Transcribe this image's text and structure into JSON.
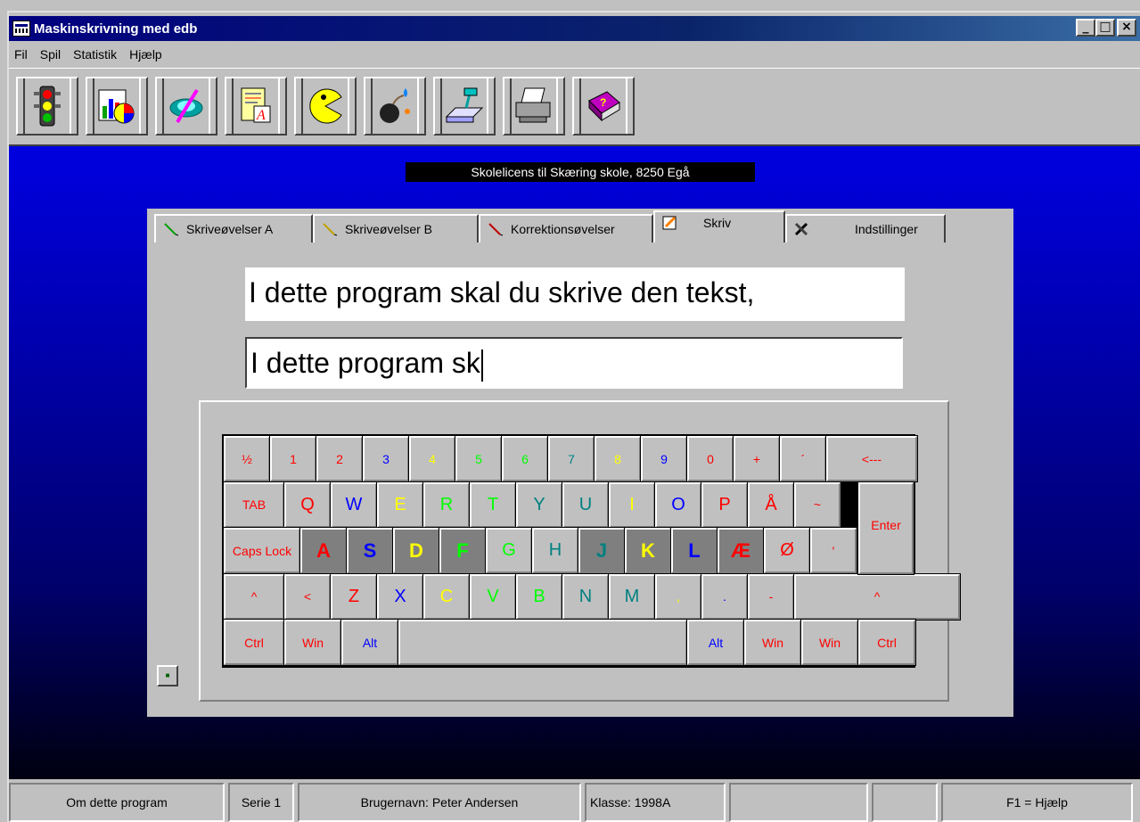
{
  "window": {
    "title": "Maskinskrivning med edb"
  },
  "menu": [
    {
      "label": "Fil"
    },
    {
      "label": "Spil"
    },
    {
      "label": "Statistik"
    },
    {
      "label": "Hjælp"
    }
  ],
  "toolbar": [
    {
      "icon": "traffic-light-icon"
    },
    {
      "icon": "statistics-chart-icon"
    },
    {
      "icon": "game-disc-icon"
    },
    {
      "icon": "document-edit-icon"
    },
    {
      "icon": "pacman-icon"
    },
    {
      "icon": "bomb-icon"
    },
    {
      "icon": "scanner-icon"
    },
    {
      "icon": "printer-icon"
    },
    {
      "icon": "help-book-icon"
    }
  ],
  "license": "Skolelicens til  Skæring skole,  8250  Egå",
  "tabs": [
    {
      "label": "Skriveøvelser A",
      "icon": "pencil-icon"
    },
    {
      "label": "Skriveøvelser B",
      "icon": "pencil-icon"
    },
    {
      "label": "Korrektionsøvelser",
      "icon": "pencil-icon"
    },
    {
      "label": "Skriv",
      "icon": "write-icon",
      "active": true
    },
    {
      "label": "Indstillinger",
      "icon": "tools-icon"
    }
  ],
  "exercise": {
    "target_text": "I dette program skal du skrive den tekst,",
    "typed_text": "I dette program sk"
  },
  "keyboard": {
    "rows": [
      [
        {
          "label": "½",
          "color": "#ff0000",
          "w": 52
        },
        {
          "label": "1",
          "color": "#ff0000",
          "w": 52
        },
        {
          "label": "2",
          "color": "#ff0000",
          "w": 52
        },
        {
          "label": "3",
          "color": "#0000ff",
          "w": 52
        },
        {
          "label": "4",
          "color": "#ffff00",
          "w": 52
        },
        {
          "label": "5",
          "color": "#00ff00",
          "w": 52
        },
        {
          "label": "6",
          "color": "#00ff00",
          "w": 52
        },
        {
          "label": "7",
          "color": "#008080",
          "w": 52
        },
        {
          "label": "8",
          "color": "#ffff00",
          "w": 52
        },
        {
          "label": "9",
          "color": "#0000ff",
          "w": 52
        },
        {
          "label": "0",
          "color": "#ff0000",
          "w": 52
        },
        {
          "label": "+",
          "color": "#ff0000",
          "w": 52
        },
        {
          "label": "´",
          "color": "#ff0000",
          "w": 52
        },
        {
          "label": "<---",
          "color": "#ff0000",
          "w": 102
        }
      ],
      [
        {
          "label": "TAB",
          "color": "#ff0000",
          "w": 68
        },
        {
          "label": "Q",
          "color": "#ff0000",
          "w": 52,
          "big": true
        },
        {
          "label": "W",
          "color": "#0000ff",
          "w": 52,
          "big": true
        },
        {
          "label": "E",
          "color": "#ffff00",
          "w": 52,
          "big": true
        },
        {
          "label": "R",
          "color": "#00ff00",
          "w": 52,
          "big": true
        },
        {
          "label": "T",
          "color": "#00ff00",
          "w": 52,
          "big": true
        },
        {
          "label": "Y",
          "color": "#008080",
          "w": 52,
          "big": true
        },
        {
          "label": "U",
          "color": "#008080",
          "w": 52,
          "big": true
        },
        {
          "label": "I",
          "color": "#ffff00",
          "w": 52,
          "big": true
        },
        {
          "label": "O",
          "color": "#0000ff",
          "w": 52,
          "big": true
        },
        {
          "label": "P",
          "color": "#ff0000",
          "w": 52,
          "big": true
        },
        {
          "label": "Å",
          "color": "#ff0000",
          "w": 52,
          "big": true
        },
        {
          "label": "~",
          "color": "#ff0000",
          "w": 52
        }
      ],
      [
        {
          "label": "Caps Lock",
          "color": "#ff0000",
          "w": 86
        },
        {
          "label": "A",
          "color": "#ff0000",
          "w": 52,
          "home": true
        },
        {
          "label": "S",
          "color": "#0000ff",
          "w": 52,
          "home": true
        },
        {
          "label": "D",
          "color": "#ffff00",
          "w": 52,
          "home": true
        },
        {
          "label": "F",
          "color": "#00ff00",
          "w": 52,
          "home": true
        },
        {
          "label": "G",
          "color": "#00ff00",
          "w": 52,
          "big": true
        },
        {
          "label": "H",
          "color": "#008080",
          "w": 52,
          "big": true
        },
        {
          "label": "J",
          "color": "#008080",
          "w": 52,
          "home": true
        },
        {
          "label": "K",
          "color": "#ffff00",
          "w": 52,
          "home": true
        },
        {
          "label": "L",
          "color": "#0000ff",
          "w": 52,
          "home": true
        },
        {
          "label": "Æ",
          "color": "#ff0000",
          "w": 52,
          "home": true
        },
        {
          "label": "Ø",
          "color": "#ff0000",
          "w": 52,
          "big": true
        },
        {
          "label": "'",
          "color": "#ff0000",
          "w": 52
        }
      ],
      [
        {
          "label": "^",
          "color": "#ff0000",
          "w": 68
        },
        {
          "label": "<",
          "color": "#ff0000",
          "w": 52
        },
        {
          "label": "Z",
          "color": "#ff0000",
          "w": 52,
          "big": true
        },
        {
          "label": "X",
          "color": "#0000ff",
          "w": 52,
          "big": true
        },
        {
          "label": "C",
          "color": "#ffff00",
          "w": 52,
          "big": true
        },
        {
          "label": "V",
          "color": "#00ff00",
          "w": 52,
          "big": true
        },
        {
          "label": "B",
          "color": "#00ff00",
          "w": 52,
          "big": true
        },
        {
          "label": "N",
          "color": "#008080",
          "w": 52,
          "big": true
        },
        {
          "label": "M",
          "color": "#008080",
          "w": 52,
          "big": true
        },
        {
          "label": ",",
          "color": "#ffff00",
          "w": 52
        },
        {
          "label": ".",
          "color": "#0000ff",
          "w": 52
        },
        {
          "label": "-",
          "color": "#ff0000",
          "w": 52
        },
        {
          "label": "^",
          "color": "#ff0000",
          "w": 186
        }
      ],
      [
        {
          "label": "Ctrl",
          "color": "#ff0000",
          "w": 68
        },
        {
          "label": "Win",
          "color": "#ff0000",
          "w": 64
        },
        {
          "label": "Alt",
          "color": "#0000ff",
          "w": 64
        },
        {
          "label": "",
          "color": "#000000",
          "w": 324
        },
        {
          "label": "Alt",
          "color": "#0000ff",
          "w": 64
        },
        {
          "label": "Win",
          "color": "#ff0000",
          "w": 64
        },
        {
          "label": "Win",
          "color": "#ff0000",
          "w": 64
        },
        {
          "label": "Ctrl",
          "color": "#ff0000",
          "w": 64
        }
      ]
    ],
    "enter_label": "Enter",
    "enter_color": "#ff0000"
  },
  "statusbar": [
    {
      "label": "Om dette program",
      "w": 242
    },
    {
      "label": "Serie 1",
      "w": 74
    },
    {
      "label": "Brugernavn: Peter Andersen",
      "w": 318
    },
    {
      "label": "Klasse: 1998A",
      "w": 158,
      "align": "left"
    },
    {
      "label": "",
      "w": 156
    },
    {
      "label": "",
      "w": 74
    },
    {
      "label": "F1 = Hjælp",
      "w": 215
    }
  ],
  "colors": {
    "title_bar": "#000080",
    "client_background_top": "#0000e0",
    "client_background_bottom": "#000010"
  }
}
